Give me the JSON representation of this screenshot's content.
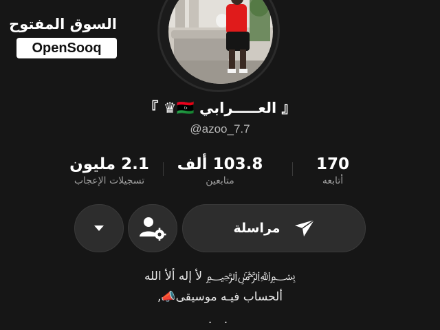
{
  "watermark": {
    "arabic": "السوق المفتوح",
    "english": "OpenSooq"
  },
  "profile": {
    "name": "『 العـــــرابي 🇱🇾♛ 』",
    "handle": "@azoo_7.7"
  },
  "stats": [
    {
      "value": "170",
      "label": "أتابعه"
    },
    {
      "value": "103.8 ألف",
      "label": "متابعين"
    },
    {
      "value": "2.1 مليون",
      "label": "تسجيلات الإعجاب"
    }
  ],
  "buttons": {
    "message_label": "مراسلة",
    "message_icon": "send-icon",
    "person_icon": "person-settings-icon",
    "dropdown_icon": "caret-down-icon"
  },
  "bio": {
    "line1": "﷽ لأ إله ألأ الله",
    "line2": "ألحساب فيـه موسيقى📣,",
    "line3": ". ."
  },
  "colors": {
    "background": "#161616",
    "button_bg": "#2d2d2d",
    "label_gray": "#9b9b9b"
  }
}
